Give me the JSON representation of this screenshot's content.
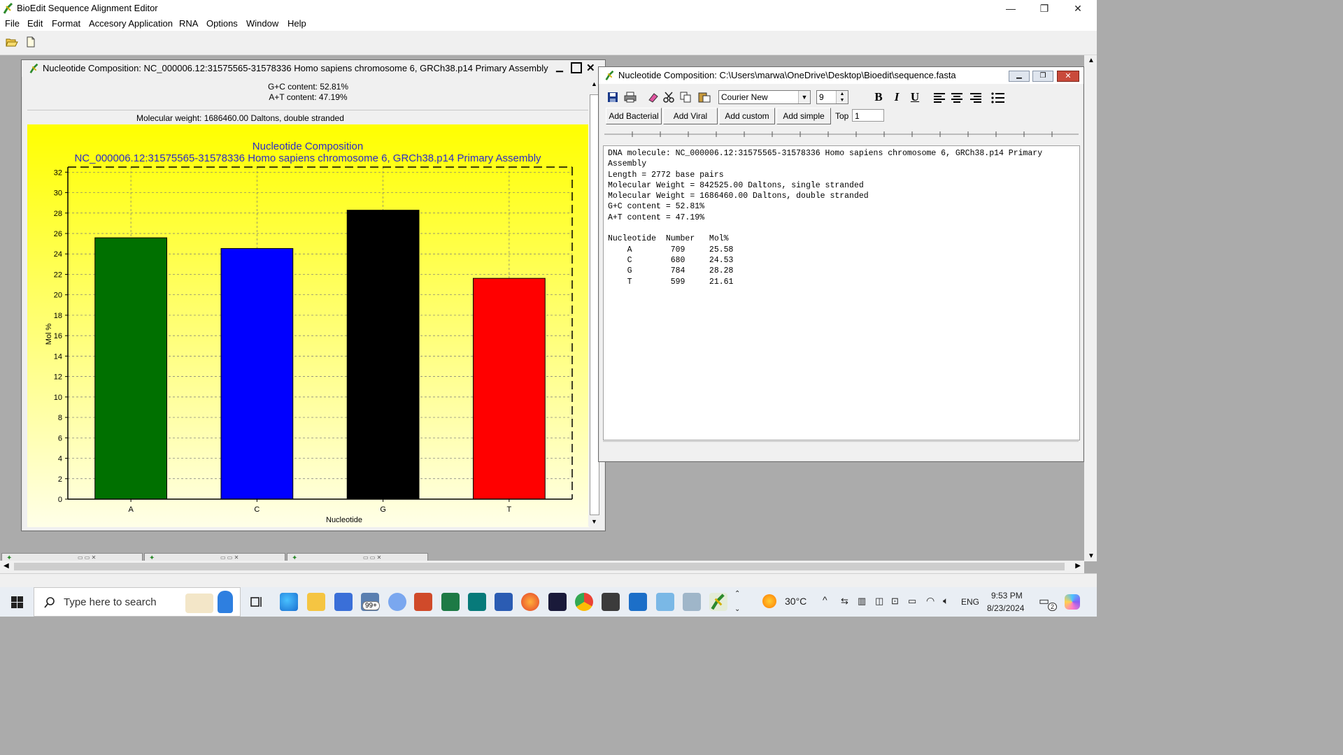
{
  "app": {
    "title": "BioEdit Sequence Alignment Editor",
    "window_controls": {
      "minimize": "—",
      "maximize": "❐",
      "close": "✕"
    }
  },
  "menu": [
    "File",
    "Edit",
    "Format",
    "Accesory Application",
    "RNA",
    "Options",
    "Window",
    "Help"
  ],
  "toolbar": {
    "icons": [
      "open-folder-icon",
      "new-document-icon"
    ]
  },
  "chart_window": {
    "title": "Nucleotide Composition: NC_000006.12:31575565-31578336 Homo sapiens chromosome 6, GRCh38.p14 Primary Assembly",
    "gc_content": "G+C content: 52.81%",
    "at_content": "A+T content: 47.19%",
    "molecular_weight": "Molecular weight: 1686460.00 Daltons, double stranded"
  },
  "chart_data": {
    "type": "bar",
    "title": "Nucleotide Composition",
    "subtitle": "NC_000006.12:31575565-31578336 Homo sapiens chromosome 6, GRCh38.p14 Primary Assembly",
    "xlabel": "Nucleotide",
    "ylabel": "Mol %",
    "categories": [
      "A",
      "C",
      "G",
      "T"
    ],
    "values": [
      25.58,
      24.53,
      28.28,
      21.61
    ],
    "colors": [
      "#007000",
      "#0000ff",
      "#000000",
      "#ff0000"
    ],
    "ylim": [
      0,
      32.5
    ],
    "yticks": [
      0,
      2,
      4,
      6,
      8,
      10,
      12,
      14,
      16,
      18,
      20,
      22,
      24,
      26,
      28,
      30,
      32
    ],
    "grid": true,
    "background": [
      "#ffff00",
      "#ffffe8"
    ]
  },
  "text_window": {
    "title": "Nucleotide Composition: C:\\Users\\marwa\\OneDrive\\Desktop\\Bioedit\\sequence.fasta",
    "font_name": "Courier New",
    "font_size": "9",
    "buttons": {
      "add_bacterial": "Add Bacterial",
      "add_viral": "Add Viral",
      "add_custom": "Add custom",
      "add_simple": "Add simple"
    },
    "top_label": "Top",
    "top_value": "1",
    "format_buttons": {
      "bold": "B",
      "italic": "I",
      "underline": "U"
    },
    "lines": [
      "DNA molecule: NC_000006.12:31575565-31578336 Homo sapiens chromosome 6, GRCh38.p14 Primary",
      "Assembly",
      "Length = 2772 base pairs",
      "Molecular Weight = 842525.00 Daltons, single stranded",
      "Molecular Weight = 1686460.00 Daltons, double stranded",
      "G+C content = 52.81%",
      "A+T content = 47.19%",
      "",
      "Nucleotide  Number   Mol%",
      "    A        709     25.58",
      "    C        680     24.53",
      "    G        784     28.28",
      "    T        599     21.61"
    ]
  },
  "taskbar": {
    "search_placeholder": "Type here to search",
    "weather": "30°C",
    "language": "ENG",
    "time": "9:53 PM",
    "date": "8/23/2024",
    "notification_count": "2",
    "mail_badge": "99+"
  }
}
